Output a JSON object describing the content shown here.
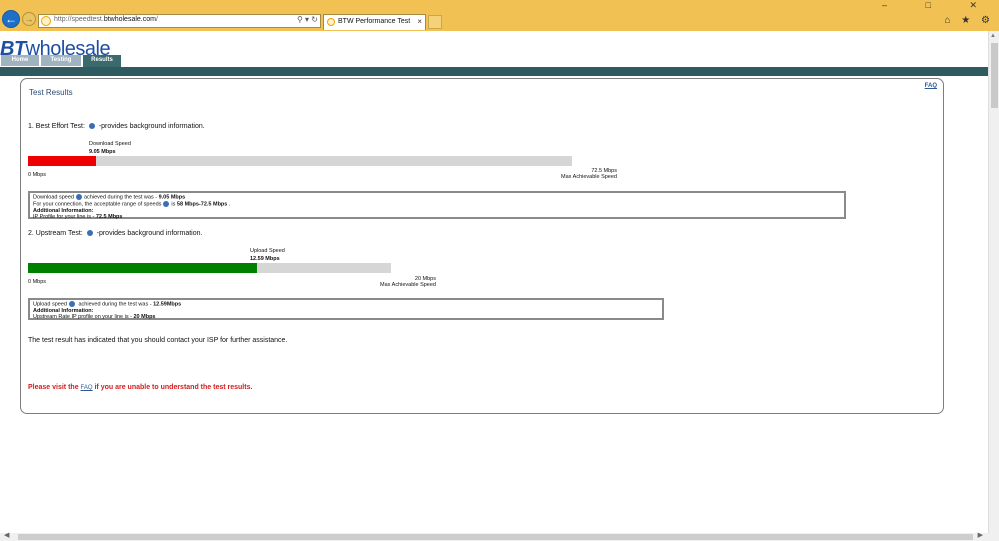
{
  "browser": {
    "url_prefix": "http://speedtest.",
    "url_domain": "btwholesale.com",
    "url_suffix": "/",
    "address_icons": "⚲ ▾ ↻",
    "tab_title": "BTW Performance Test",
    "tab_close": "×",
    "window_buttons": "– □ ✕",
    "tool_icons": "⌂ ★ ⚙"
  },
  "site": {
    "logo_bt": "BT",
    "logo_rest": "wholesale",
    "nav": {
      "home": "Home",
      "testing": "Testing",
      "results": "Results"
    }
  },
  "panel": {
    "title": "Test Results",
    "faq": "FAQ"
  },
  "download": {
    "heading_pre": "1. Best Effort Test: ",
    "heading_post": " -provides background information.",
    "label": "Download Speed",
    "value_text": "9.05 Mbps",
    "value": 9.05,
    "max": 72.5,
    "min_label": "0 Mbps",
    "max_label": "72.5 Mbps",
    "max_caption": "Max Achievable Speed",
    "color": "#ee0000",
    "box": {
      "line1_pre": "Download speed",
      "line1_mid": "achieved during the test was - ",
      "line1_val": "9.05 Mbps",
      "line2_pre": "For your connection, the acceptable range of speeds",
      "line2_mid": "is ",
      "line2_val": "58 Mbps-72.5 Mbps",
      "line2_end": " .",
      "line3": "Additional Information:",
      "line4_pre": "IP Profile for your line is - ",
      "line4_val": "72.5 Mbps"
    }
  },
  "upload": {
    "heading_pre": "2. Upstream Test: ",
    "heading_post": " -provides background information.",
    "label": "Upload Speed",
    "value_text": "12.59 Mbps",
    "value": 12.59,
    "max": 20,
    "min_label": "0 Mbps",
    "max_label": "20 Mbps",
    "max_caption": "Max Achievable Speed",
    "color": "#008000",
    "box": {
      "line1_pre": "Upload speed",
      "line1_mid": " achieved during the test was - ",
      "line1_val": "12.59Mbps",
      "line2": "Additional Information:",
      "line3_pre": "Upstream Rate IP profile on your line is - ",
      "line3_val": "20 Mbps"
    }
  },
  "message": "The test result has indicated that you should contact your ISP for further assistance.",
  "visit": {
    "pre": "Please visit the ",
    "link": "FAQ",
    "post": " if you are unable to understand the test results."
  }
}
